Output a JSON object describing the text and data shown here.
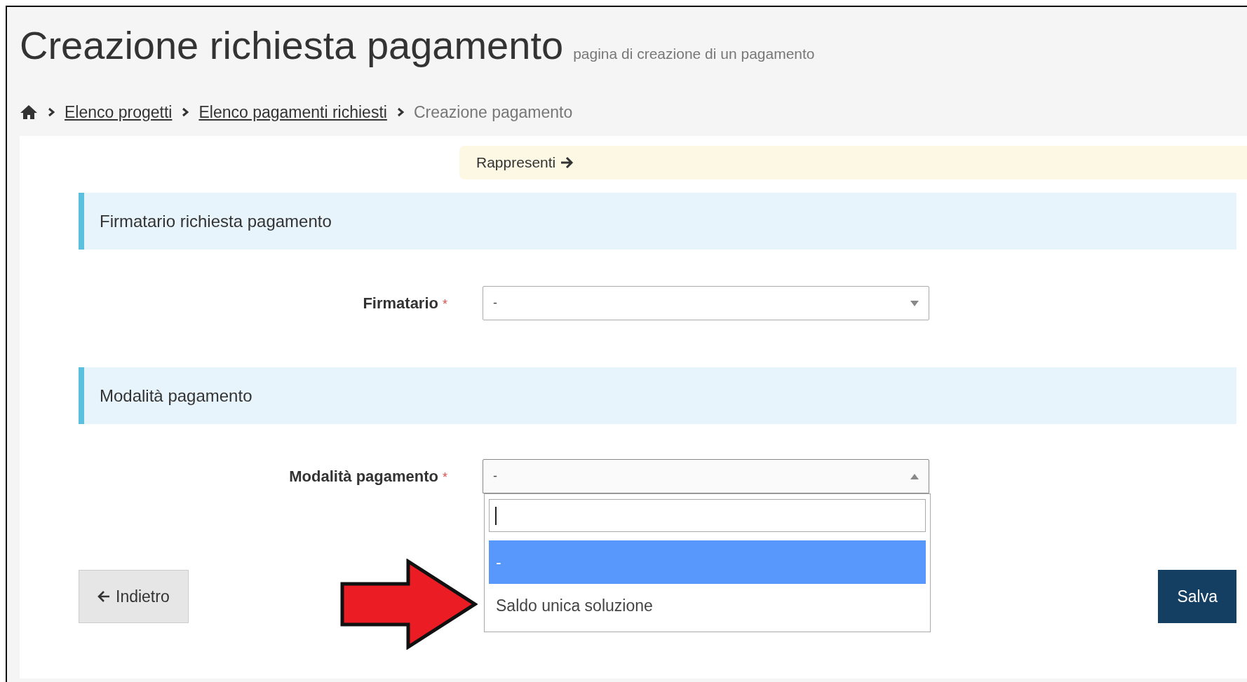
{
  "page_header": {
    "title": "Creazione richiesta pagamento",
    "subtitle": "pagina di creazione di un pagamento"
  },
  "breadcrumb": {
    "items": [
      {
        "label": "Elenco progetti",
        "kind": "link"
      },
      {
        "label": "Elenco pagamenti richiesti",
        "kind": "link"
      },
      {
        "label": "Creazione pagamento",
        "kind": "current"
      }
    ]
  },
  "notice": {
    "text": "Rappresenti"
  },
  "sections": [
    {
      "heading": "Firmatario richiesta pagamento",
      "field": {
        "label": "Firmatario",
        "required_mark": "*",
        "value": "-",
        "expanded": false
      }
    },
    {
      "heading": "Modalità pagamento",
      "field": {
        "label": "Modalità pagamento",
        "required_mark": "*",
        "value": "-",
        "expanded": true,
        "options": [
          {
            "label": "-",
            "selected": true
          },
          {
            "label": "Saldo unica soluzione",
            "selected": false
          }
        ]
      }
    }
  ],
  "buttons": [
    {
      "label": "Indietro",
      "kind": "back"
    },
    {
      "label": "Salva",
      "kind": "primary"
    }
  ]
}
